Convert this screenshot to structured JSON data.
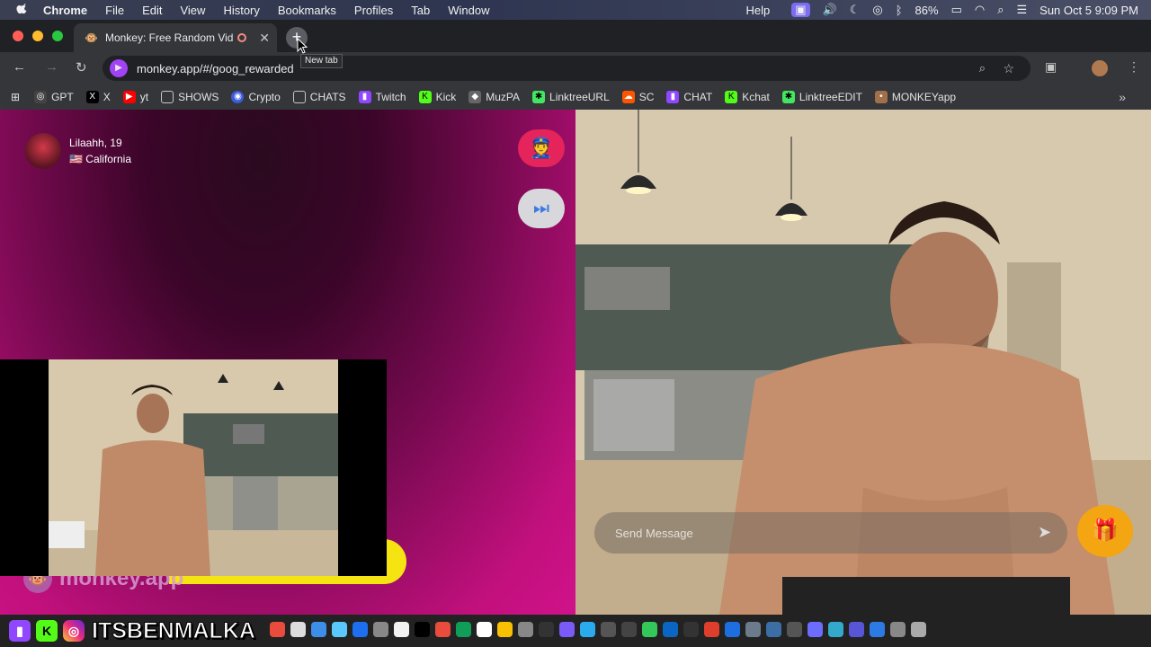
{
  "menubar": {
    "apple": "",
    "items": [
      "Chrome",
      "File",
      "Edit",
      "View",
      "History",
      "Bookmarks",
      "Profiles",
      "Tab",
      "Window"
    ],
    "help": "Help",
    "battery": "86%",
    "datetime": "Sun Oct 5  9:09 PM"
  },
  "tab": {
    "title": "Monkey: Free Random Vid",
    "new_tab_tooltip": "New tab"
  },
  "toolbar": {
    "url": "monkey.app/#/goog_rewarded"
  },
  "bookmarks": [
    {
      "label": "GPT",
      "color": "#444444",
      "glyph": "◎"
    },
    {
      "label": "X",
      "color": "#000000",
      "glyph": "X"
    },
    {
      "label": "yt",
      "color": "#ff0000",
      "glyph": "▶"
    },
    {
      "label": "SHOWS",
      "color": "transparent",
      "glyph": "▭"
    },
    {
      "label": "Crypto",
      "color": "#3b5bdb",
      "glyph": "◉"
    },
    {
      "label": "CHATS",
      "color": "transparent",
      "glyph": "▭"
    },
    {
      "label": "Twitch",
      "color": "#9146ff",
      "glyph": "▮"
    },
    {
      "label": "Kick",
      "color": "#53fc18",
      "glyph": "K"
    },
    {
      "label": "MuzPA",
      "color": "#666666",
      "glyph": "◆"
    },
    {
      "label": "LinktreeURL",
      "color": "#43e660",
      "glyph": "✱"
    },
    {
      "label": "SC",
      "color": "#ff5500",
      "glyph": "☁"
    },
    {
      "label": "CHAT",
      "color": "#9146ff",
      "glyph": "▮"
    },
    {
      "label": "Kchat",
      "color": "#53fc18",
      "glyph": "K"
    },
    {
      "label": "LinktreeEDIT",
      "color": "#43e660",
      "glyph": "✱"
    },
    {
      "label": "MONKEYapp",
      "color": "#a0704a",
      "glyph": "🐵"
    }
  ],
  "peer": {
    "name_age": "Lilaahh, 19",
    "flag": "🇺🇸",
    "location": "California"
  },
  "brand": {
    "text": "monkey.app"
  },
  "chat": {
    "placeholder": "Send Message"
  },
  "overlay": {
    "handle": "ITSBENMALKA"
  },
  "colors": {
    "accent_pink": "#d0128a",
    "report_red": "#e4245a",
    "gift_orange": "#f3a512",
    "highlight_yellow": "#f6e312"
  }
}
